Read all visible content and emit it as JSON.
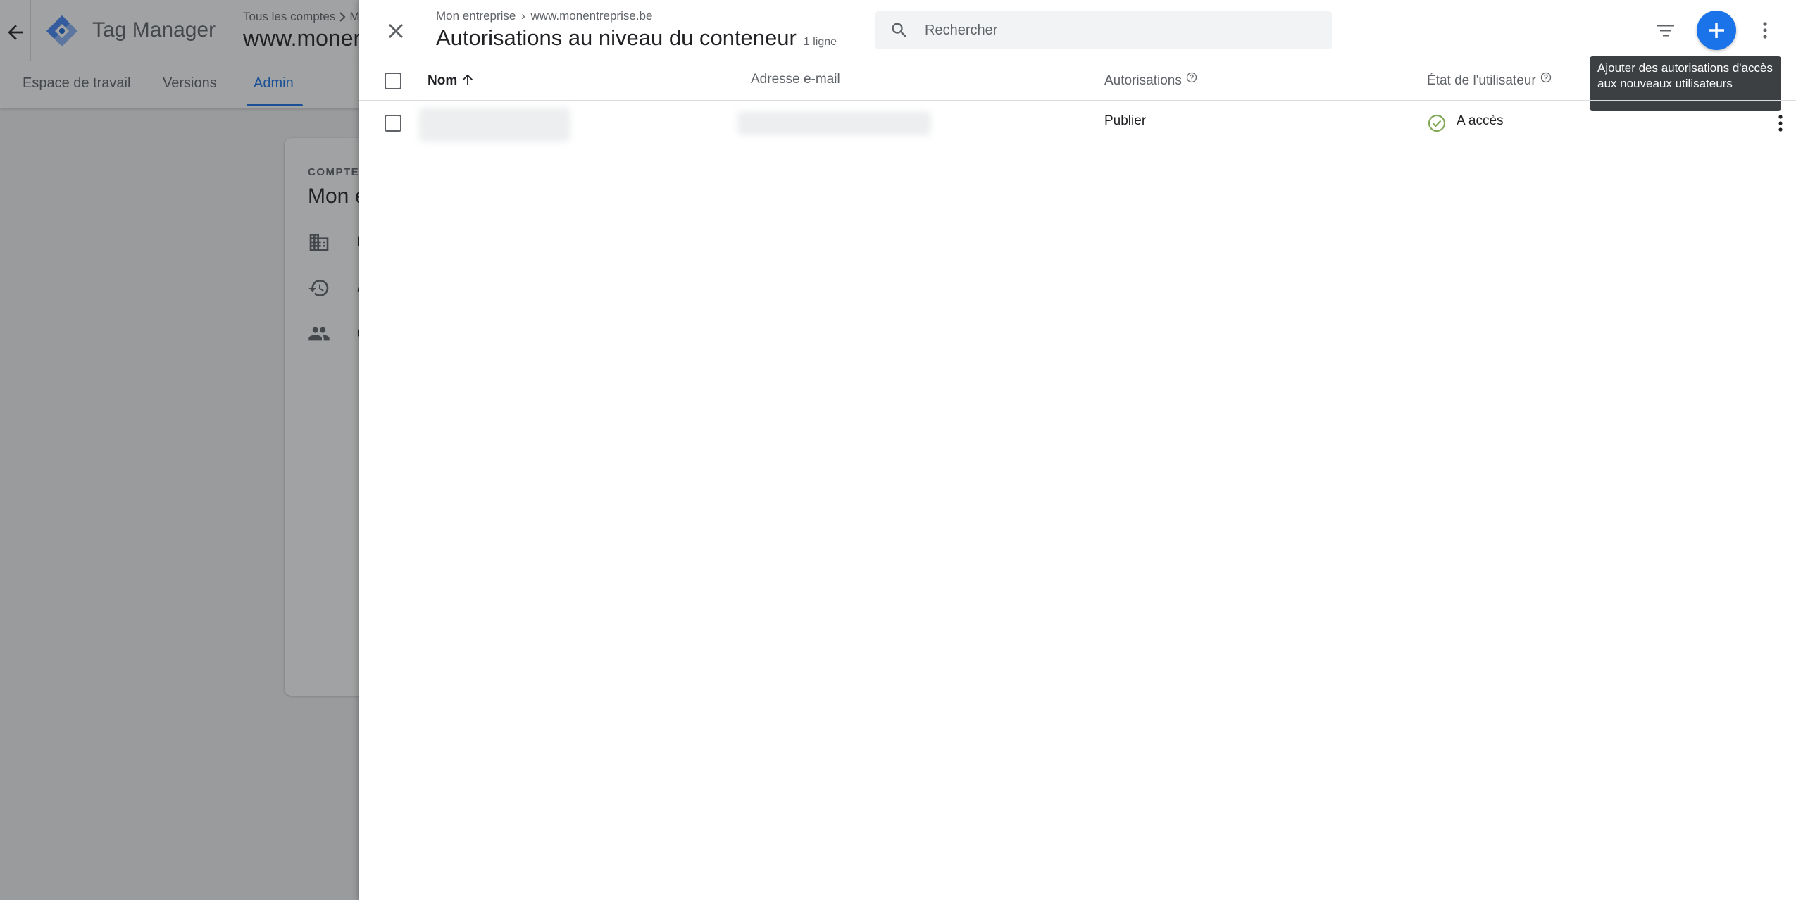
{
  "background": {
    "app_name": "Tag Manager",
    "breadcrumb_all_accounts": "Tous les comptes",
    "breadcrumb_next": "M",
    "container_name": "www.moner",
    "nav_tabs": [
      "Espace de travail",
      "Versions",
      "Admin"
    ],
    "active_tab": "Admin",
    "card": {
      "label": "COMPTE",
      "title": "Mon e",
      "rows": [
        "P",
        "A",
        "G"
      ]
    }
  },
  "panel": {
    "breadcrumb_account": "Mon entreprise",
    "breadcrumb_sep": "›",
    "breadcrumb_container": "www.monentreprise.be",
    "title": "Autorisations au niveau du conteneur",
    "row_count": "1 ligne",
    "search_placeholder": "Rechercher",
    "tooltip": "Ajouter des autorisations d'accès aux nouveaux utilisateurs",
    "columns": {
      "name": "Nom",
      "email": "Adresse e-mail",
      "permissions": "Autorisations",
      "status": "État de l'utilisateur"
    },
    "rows": [
      {
        "name": "",
        "email": "",
        "permission": "Publier",
        "status": "A accès"
      }
    ]
  },
  "colors": {
    "accent": "#1a73e8",
    "status_ok": "#81a957",
    "scrim": "rgba(32,33,36,0.42)",
    "tooltip_bg": "#3c4043"
  }
}
